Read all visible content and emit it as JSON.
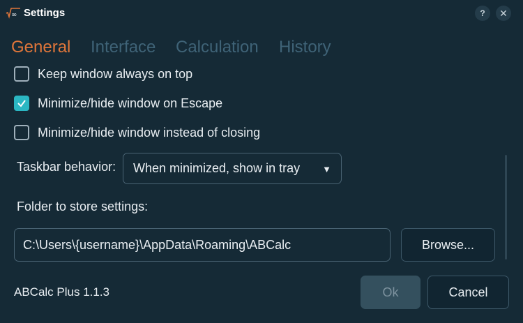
{
  "window": {
    "title": "Settings",
    "help_button": "?",
    "close_button": "✕"
  },
  "tabs": [
    {
      "label": "General",
      "active": true
    },
    {
      "label": "Interface",
      "active": false
    },
    {
      "label": "Calculation",
      "active": false
    },
    {
      "label": "History",
      "active": false
    }
  ],
  "general": {
    "options": [
      {
        "label": "Keep window always on top",
        "checked": false
      },
      {
        "label": "Minimize/hide window on Escape",
        "checked": true
      },
      {
        "label": "Minimize/hide window instead of closing",
        "checked": false
      }
    ],
    "taskbar_label": "Taskbar behavior:",
    "taskbar_value": "When minimized, show in tray",
    "folder_label": "Folder to store settings:",
    "folder_path": "C:\\Users\\{username}\\AppData\\Roaming\\ABCalc",
    "browse_label": "Browse..."
  },
  "footer": {
    "version": "ABCalc Plus 1.1.3",
    "ok_label": "Ok",
    "cancel_label": "Cancel"
  },
  "colors": {
    "background": "#152a36",
    "accent_tab": "#e0763a",
    "checkbox_checked": "#2bb7c3"
  }
}
